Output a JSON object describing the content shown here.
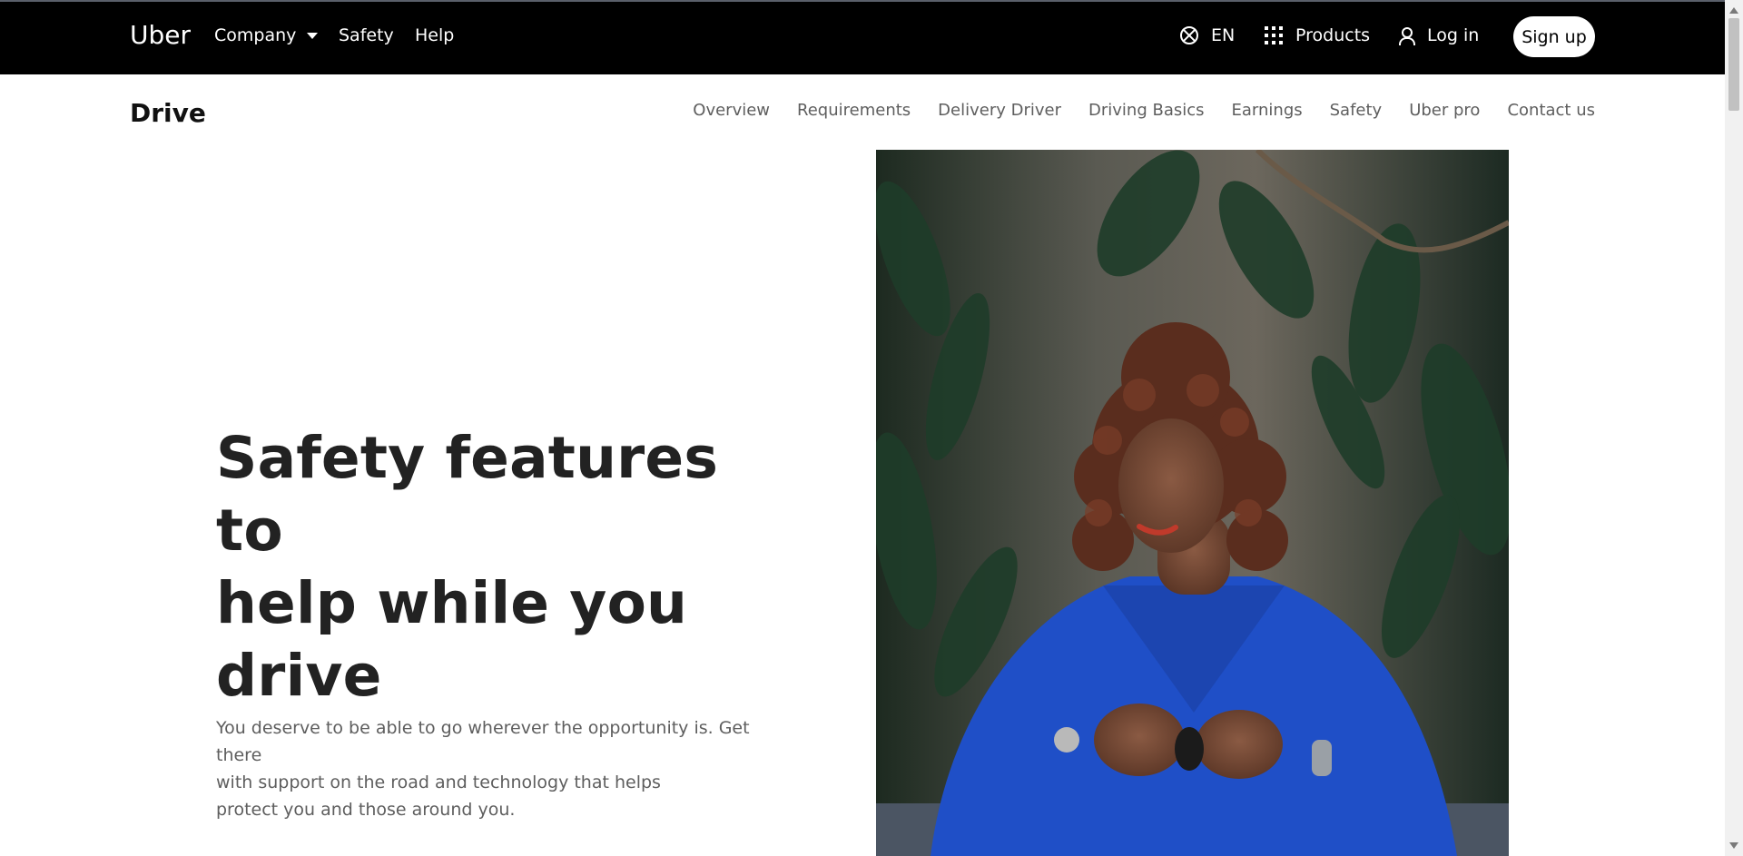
{
  "topbar": {
    "brand": "Uber",
    "company_label": "Company",
    "safety_label": "Safety",
    "help_label": "Help",
    "language_label": "EN",
    "products_label": "Products",
    "login_label": "Log in",
    "signup_label": "Sign up"
  },
  "subnav": {
    "title": "Drive",
    "links": [
      "Overview",
      "Requirements",
      "Delivery Driver",
      "Driving Basics",
      "Earnings",
      "Safety",
      "Uber pro",
      "Contact us"
    ]
  },
  "hero": {
    "title_line1": "Safety features to",
    "title_line2": "help while you drive",
    "description_line1": "You deserve to be able to go wherever the opportunity is. Get there",
    "description_line2": "with support on the road and technology that helps",
    "description_line3": "protect you and those around you."
  },
  "icons": {
    "language": "globe-icon",
    "products": "grid-icon",
    "login": "user-icon",
    "company_dropdown": "caret-down-icon"
  },
  "colors": {
    "topbar_bg": "#000000",
    "topbar_text": "#ffffff",
    "signup_bg": "#ffffff",
    "subnav_text": "#5e5e5e",
    "title_text": "#222222"
  }
}
